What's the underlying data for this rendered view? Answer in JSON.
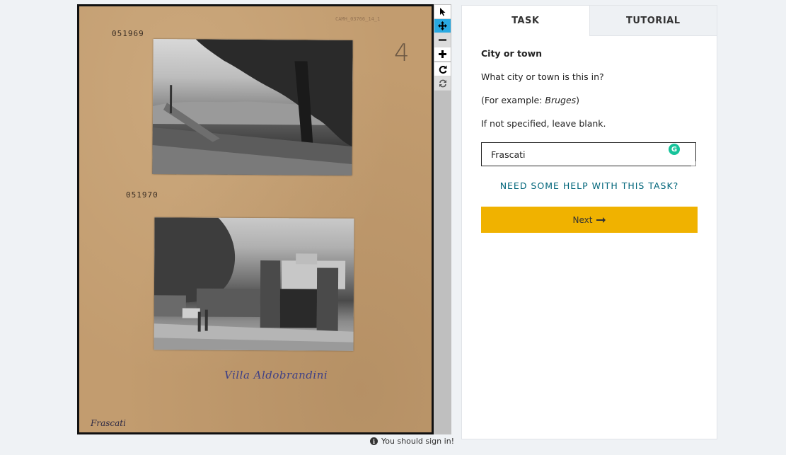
{
  "subject": {
    "corner_code": "CAMH_03766_14_1",
    "stamp_top": "051969",
    "stamp_mid": "051970",
    "pencil_number": "4",
    "caption": "Villa Aldobrandini",
    "corner_label": "Frascati"
  },
  "toolbar": {
    "icons": [
      "pointer-icon",
      "move-icon",
      "zoom-out-icon",
      "zoom-in-icon",
      "rotate-icon",
      "reset-icon"
    ],
    "active": "move-icon",
    "accent": "#29a9e1"
  },
  "signin": {
    "text": "You should sign in!"
  },
  "panel": {
    "tabs": [
      {
        "label": "TASK",
        "active": true
      },
      {
        "label": "TUTORIAL",
        "active": false
      }
    ],
    "question_title": "City or town",
    "question_text": "What city or town is this in?",
    "example_prefix": "(For example: ",
    "example_value": "Bruges",
    "example_suffix": ")",
    "instruction": "If not specified, leave blank.",
    "answer_value": "Frascati",
    "help_link": "NEED SOME HELP WITH THIS TASK?",
    "next_label": "Next",
    "next_color": "#f0b200",
    "link_color": "#00657a"
  }
}
